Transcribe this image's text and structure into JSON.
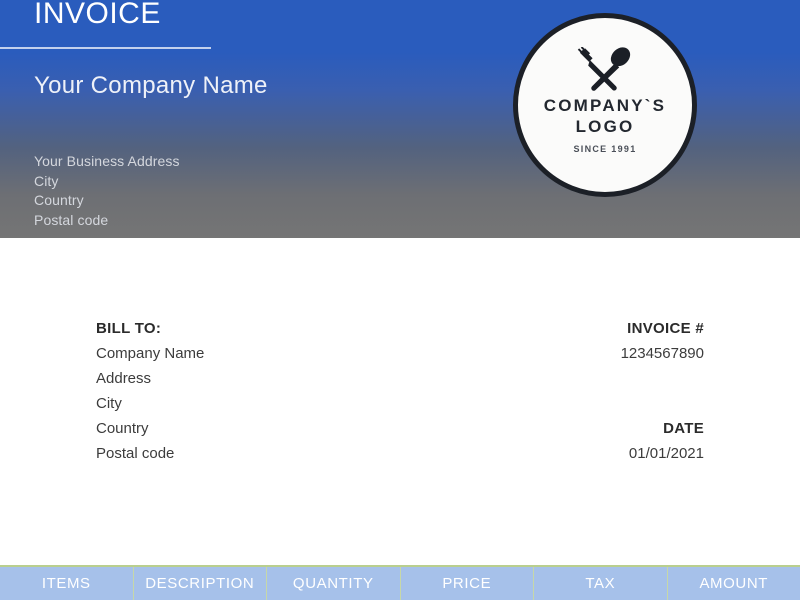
{
  "header": {
    "invoice_title": "INVOICE",
    "company_name": "Your Company Name",
    "address": [
      "Your Business Address",
      "City",
      "Country",
      "Postal code"
    ],
    "gradient_top_color": "#2a5cbd",
    "gradient_bottom_color": "#757575"
  },
  "logo": {
    "icon": "fork-and-spoon-crossed",
    "name_line1": "COMPANY`S",
    "name_line2": "LOGO",
    "since": "SINCE 1991",
    "ring_color": "#1c2027",
    "fill_color": "#fbfbfa"
  },
  "bill_to": {
    "label": "BILL TO:",
    "lines": [
      "Company Name",
      "Address",
      "City",
      "Country",
      "Postal code"
    ]
  },
  "meta": {
    "invoice_number_label": "INVOICE #",
    "invoice_number_value": "1234567890",
    "date_label": "DATE",
    "date_value": "01/01/2021"
  },
  "table": {
    "header_bg": "#a6c1ea",
    "divider_color": "#c7d8a8",
    "columns": [
      "ITEMS",
      "DESCRIPTION",
      "QUANTITY",
      "PRICE",
      "TAX",
      "AMOUNT"
    ]
  }
}
